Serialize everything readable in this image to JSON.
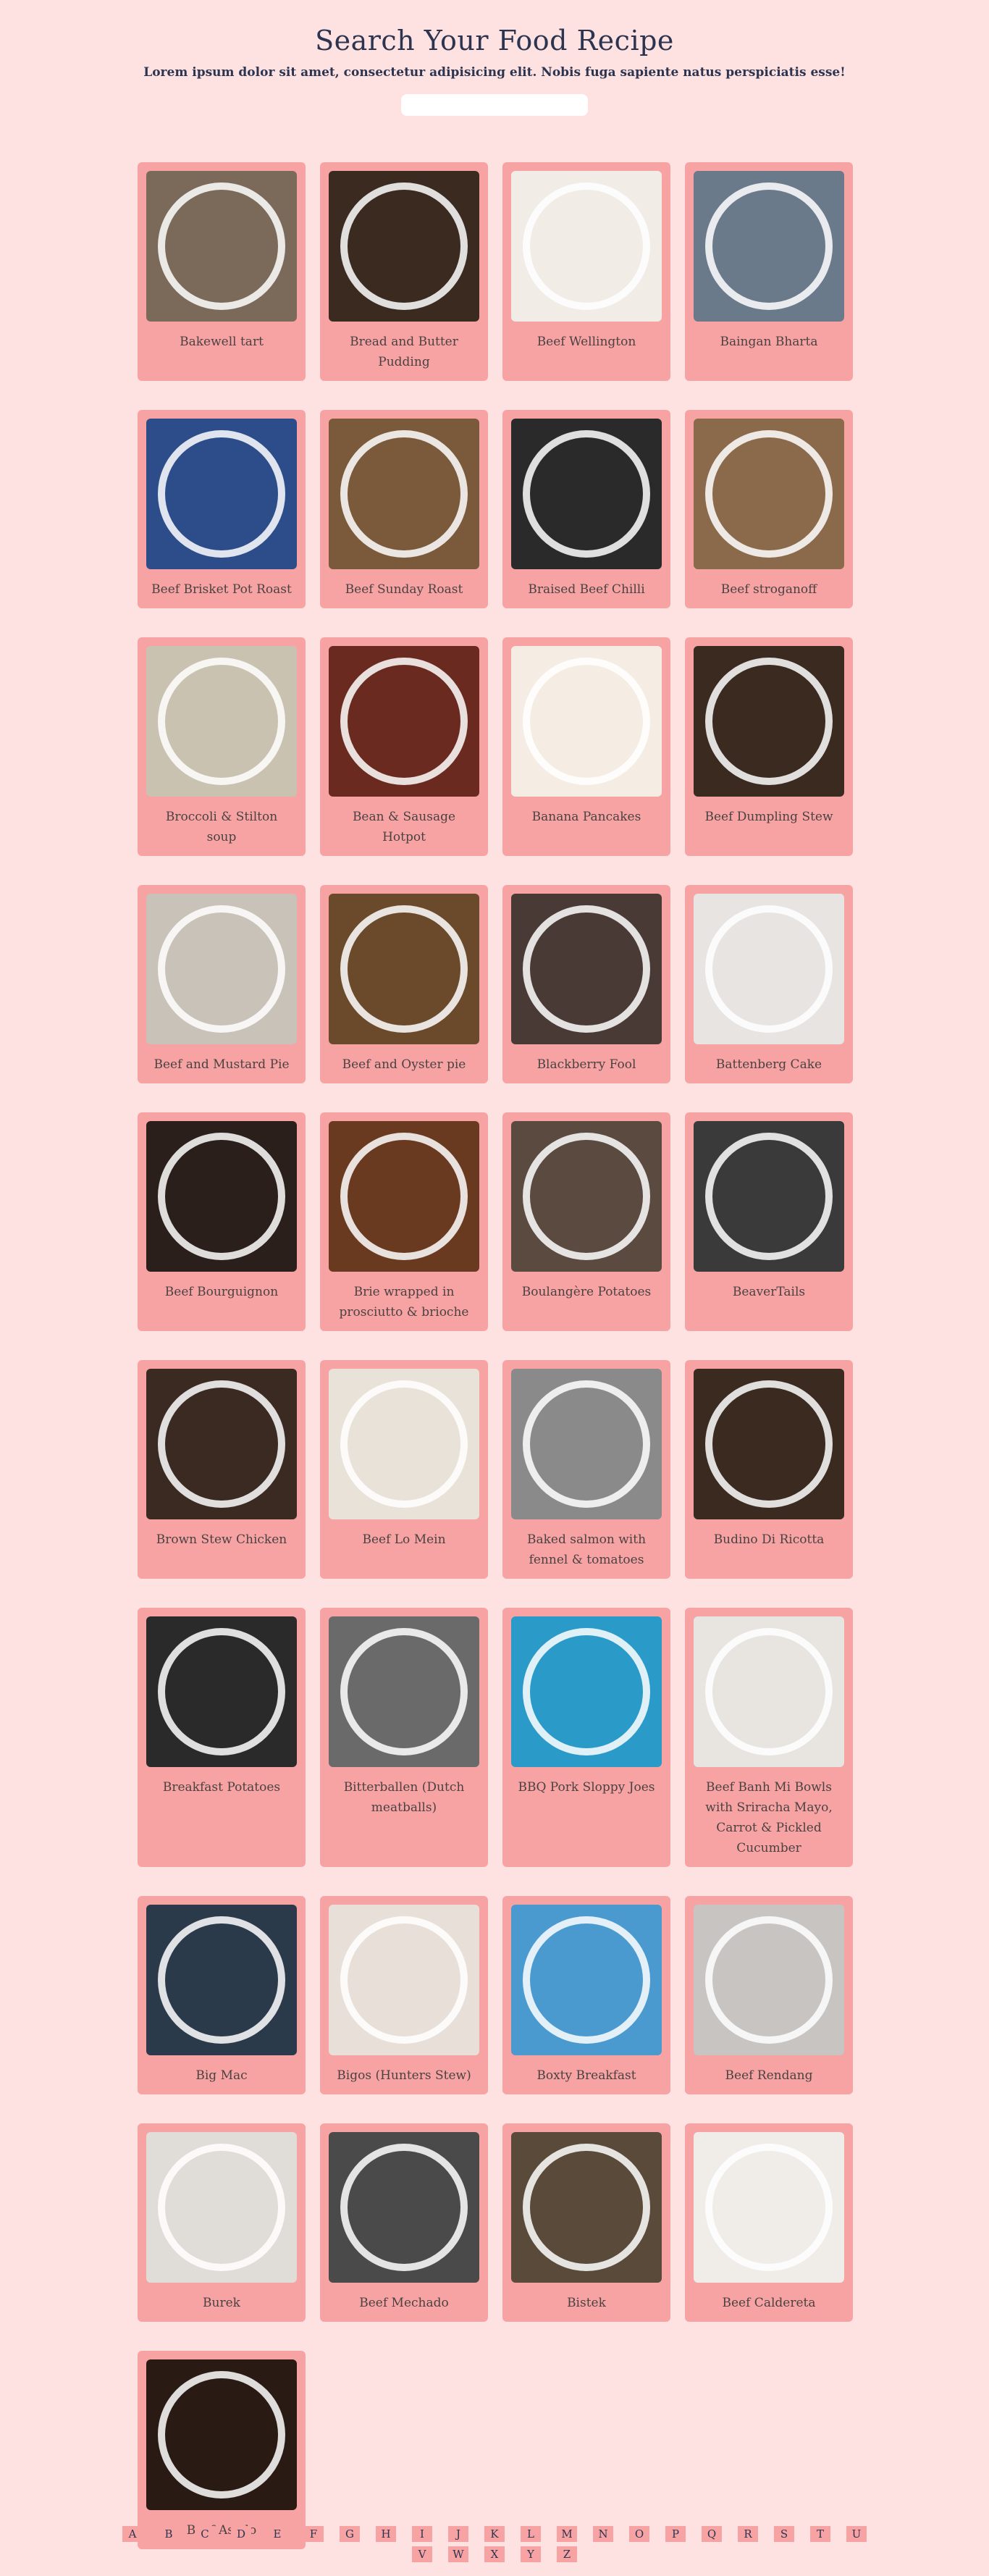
{
  "header": {
    "title": "Search Your Food Recipe",
    "subtitle": "Lorem ipsum dolor sit amet, consectetur adipisicing elit. Nobis fuga sapiente natus perspiciatis esse!",
    "search_placeholder": ""
  },
  "recipes": [
    {
      "name": "Bakewell tart",
      "color": "#7b6a5a"
    },
    {
      "name": "Bread and Butter Pudding",
      "color": "#3b2a20"
    },
    {
      "name": "Beef Wellington",
      "color": "#f1ece6"
    },
    {
      "name": "Baingan Bharta",
      "color": "#6a7a8a"
    },
    {
      "name": "Beef Brisket Pot Roast",
      "color": "#2d4d8a"
    },
    {
      "name": "Beef Sunday Roast",
      "color": "#7a5a3a"
    },
    {
      "name": "Braised Beef Chilli",
      "color": "#2a2a2a"
    },
    {
      "name": "Beef stroganoff",
      "color": "#8a6a4a"
    },
    {
      "name": "Broccoli & Stilton soup",
      "color": "#c9c2b0"
    },
    {
      "name": "Bean & Sausage Hotpot",
      "color": "#6a2a1f"
    },
    {
      "name": "Banana Pancakes",
      "color": "#f5ede4"
    },
    {
      "name": "Beef Dumpling Stew",
      "color": "#3a2a20"
    },
    {
      "name": "Beef and Mustard Pie",
      "color": "#c8c2b8"
    },
    {
      "name": "Beef and Oyster pie",
      "color": "#6a4a2a"
    },
    {
      "name": "Blackberry Fool",
      "color": "#4a3a35"
    },
    {
      "name": "Battenberg Cake",
      "color": "#e8e4e2"
    },
    {
      "name": "Beef Bourguignon",
      "color": "#2a1f1a"
    },
    {
      "name": "Brie wrapped in prosciutto & brioche",
      "color": "#6a3a20"
    },
    {
      "name": "Boulangère Potatoes",
      "color": "#5a4a40"
    },
    {
      "name": "BeaverTails",
      "color": "#3a3a3a"
    },
    {
      "name": "Brown Stew Chicken",
      "color": "#3a2a22"
    },
    {
      "name": "Beef Lo Mein",
      "color": "#e8e2d8"
    },
    {
      "name": "Baked salmon with fennel & tomatoes",
      "color": "#8a8a8a"
    },
    {
      "name": "Budino Di Ricotta",
      "color": "#3a2a1f"
    },
    {
      "name": "Breakfast Potatoes",
      "color": "#2a2a2a"
    },
    {
      "name": "Bitterballen (Dutch meatballs)",
      "color": "#6a6a6a"
    },
    {
      "name": "BBQ Pork Sloppy Joes",
      "color": "#2a9ac8"
    },
    {
      "name": "Beef Banh Mi Bowls with Sriracha Mayo, Carrot & Pickled Cucumber",
      "color": "#e8e4e0"
    },
    {
      "name": "Big Mac",
      "color": "#2a3a4a"
    },
    {
      "name": "Bigos (Hunters Stew)",
      "color": "#e8e0d8"
    },
    {
      "name": "Boxty Breakfast",
      "color": "#4a9ad0"
    },
    {
      "name": "Beef Rendang",
      "color": "#c8c4c2"
    },
    {
      "name": "Burek",
      "color": "#e0dcd8"
    },
    {
      "name": "Beef Mechado",
      "color": "#4a4a4a"
    },
    {
      "name": "Bistek",
      "color": "#5a4a3a"
    },
    {
      "name": "Beef Caldereta",
      "color": "#f0ece8"
    },
    {
      "name": "Beef Asado",
      "color": "#2a1a14"
    }
  ],
  "pager": {
    "row1": [
      "A",
      "B",
      "C",
      "D",
      "E",
      "F",
      "G",
      "H",
      "I",
      "J",
      "K",
      "L",
      "M",
      "N",
      "O",
      "P",
      "Q",
      "R",
      "S",
      "T",
      "U"
    ],
    "row2": [
      "V",
      "W",
      "X",
      "Y",
      "Z"
    ]
  }
}
